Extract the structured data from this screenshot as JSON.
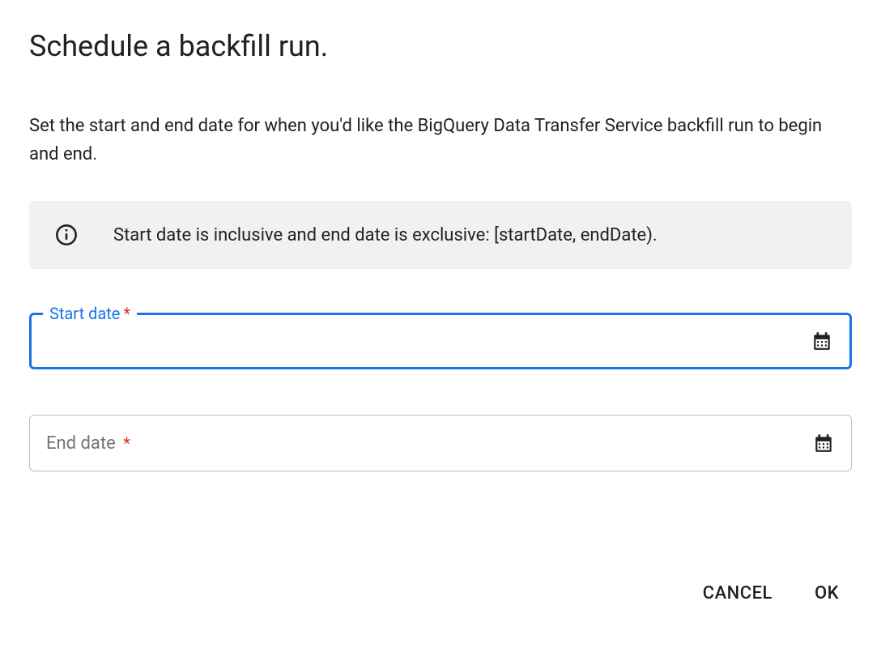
{
  "dialog": {
    "title": "Schedule a backfill run.",
    "description": "Set the start and end date for when you'd like the BigQuery Data Transfer Service backfill run to begin and end.",
    "infoBanner": {
      "text": "Start date is inclusive and end date is exclusive: [startDate, endDate)."
    },
    "fields": {
      "startDate": {
        "label": "Start date",
        "required": "*",
        "value": ""
      },
      "endDate": {
        "label": "End date",
        "required": "*",
        "value": ""
      }
    },
    "actions": {
      "cancel": "CANCEL",
      "ok": "OK"
    }
  }
}
